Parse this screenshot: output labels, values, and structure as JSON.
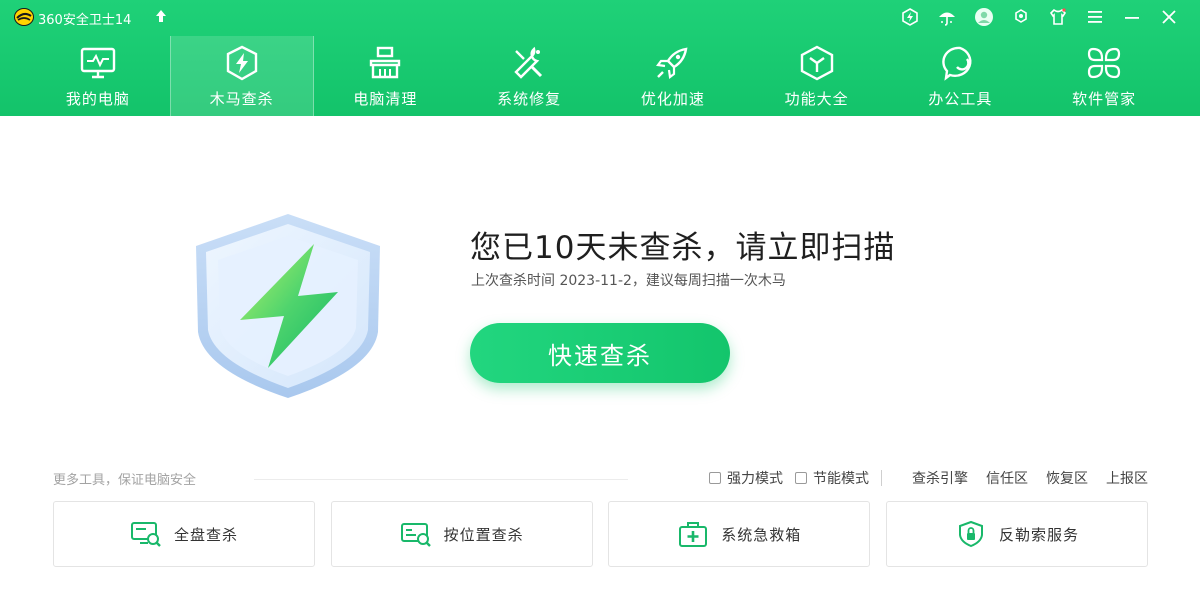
{
  "app": {
    "title": "360安全卫士14",
    "brand_color": "#18c96f"
  },
  "window_controls": [
    {
      "name": "security-badge-icon"
    },
    {
      "name": "umbrella-icon"
    },
    {
      "name": "avatar-icon"
    },
    {
      "name": "settings-icon"
    },
    {
      "name": "skin-icon"
    },
    {
      "name": "menu-icon"
    },
    {
      "name": "minimize-icon"
    },
    {
      "name": "close-icon"
    }
  ],
  "nav": {
    "items": [
      {
        "label": "我的电脑",
        "icon": "monitor-icon"
      },
      {
        "label": "木马查杀",
        "icon": "shield-bolt-icon",
        "active": true
      },
      {
        "label": "电脑清理",
        "icon": "broom-icon"
      },
      {
        "label": "系统修复",
        "icon": "wrench-icon"
      },
      {
        "label": "优化加速",
        "icon": "rocket-icon"
      },
      {
        "label": "功能大全",
        "icon": "cube-icon"
      },
      {
        "label": "办公工具",
        "icon": "chat-bubble-icon"
      },
      {
        "label": "软件管家",
        "icon": "grid-flower-icon"
      }
    ]
  },
  "hero": {
    "title": "您已10天未查杀，请立即扫描",
    "subtitle": "上次查杀时间 2023-11-2，建议每周扫描一次木马",
    "scan_button": "快速查杀"
  },
  "tools": {
    "label": "更多工具，保证电脑安全",
    "options": [
      {
        "label": "强力模式",
        "checked": false
      },
      {
        "label": "节能模式",
        "checked": false
      }
    ],
    "links": [
      "查杀引擎",
      "信任区",
      "恢复区",
      "上报区"
    ],
    "cards": [
      {
        "label": "全盘查杀",
        "icon": "full-scan-icon"
      },
      {
        "label": "按位置查杀",
        "icon": "location-scan-icon"
      },
      {
        "label": "系统急救箱",
        "icon": "first-aid-kit-icon"
      },
      {
        "label": "反勒索服务",
        "icon": "ransom-shield-icon"
      }
    ]
  }
}
